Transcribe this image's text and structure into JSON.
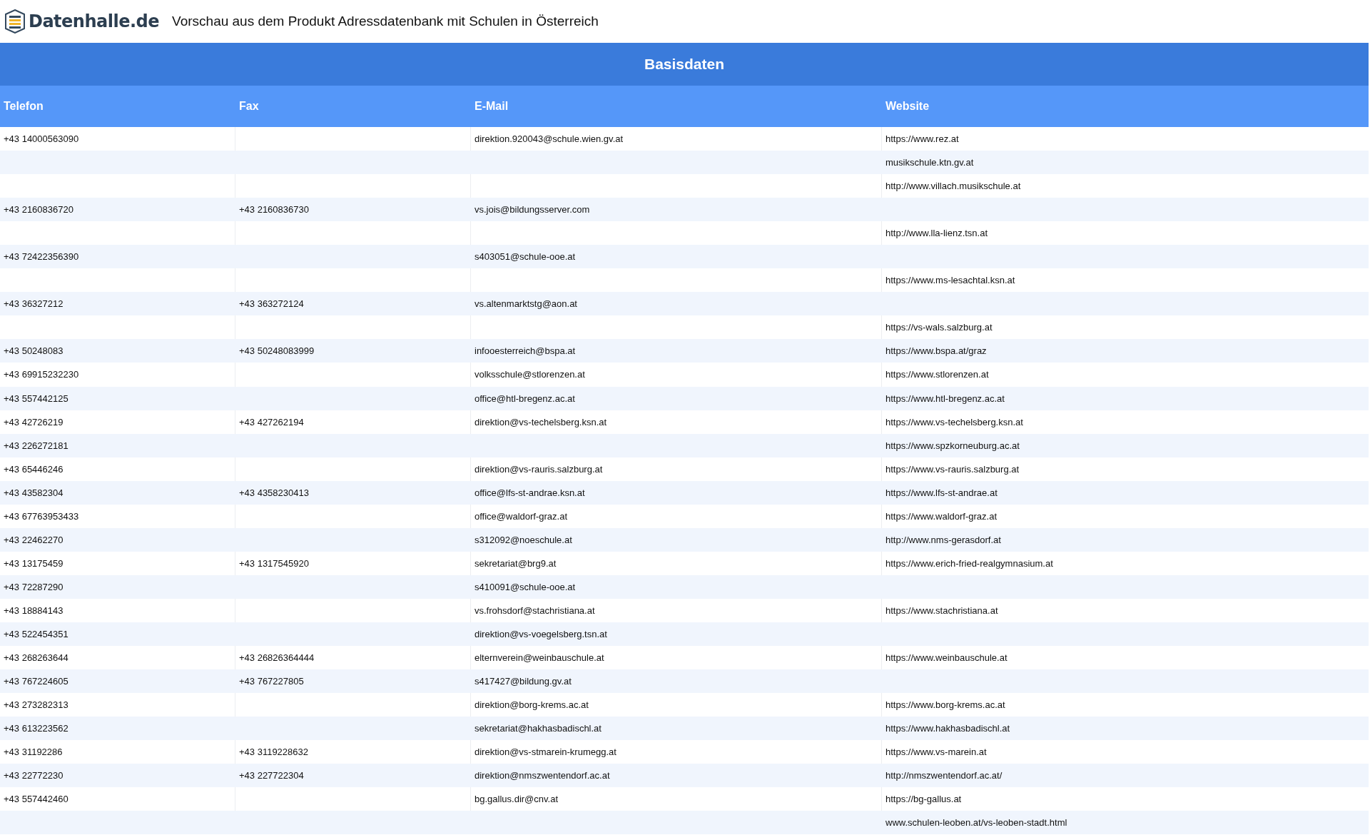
{
  "header": {
    "logo_text": "Datenhalle.de",
    "title": "Vorschau aus dem Produkt Adressdatenbank mit Schulen in Österreich"
  },
  "table": {
    "title": "Basisdaten",
    "columns": [
      "Telefon",
      "Fax",
      "E-Mail",
      "Website"
    ],
    "rows": [
      {
        "telefon": "+43 14000563090",
        "email": "direktion.920043@schule.wien.gv.at",
        "website": "https://www.rez.at"
      },
      {
        "website": "musikschule.ktn.gv.at"
      },
      {
        "website": "http://www.villach.musikschule.at"
      },
      {
        "telefon": "+43 2160836720",
        "fax": "+43 2160836730",
        "email": "vs.jois@bildungsserver.com"
      },
      {
        "website": "http://www.lla-lienz.tsn.at"
      },
      {
        "telefon": "+43 72422356390",
        "email": "s403051@schule-ooe.at"
      },
      {
        "website": "https://www.ms-lesachtal.ksn.at"
      },
      {
        "telefon": "+43 36327212",
        "fax": "+43 363272124",
        "email": "vs.altenmarktstg@aon.at"
      },
      {
        "website": "https://vs-wals.salzburg.at"
      },
      {
        "telefon": "+43 50248083",
        "fax": "+43 50248083999",
        "email": "infooesterreich@bspa.at",
        "website": "https://www.bspa.at/graz"
      },
      {
        "telefon": "+43 69915232230",
        "email": "volksschule@stlorenzen.at",
        "website": "https://www.stlorenzen.at"
      },
      {
        "telefon": "+43 557442125",
        "email": "office@htl-bregenz.ac.at",
        "website": "https://www.htl-bregenz.ac.at"
      },
      {
        "telefon": "+43 42726219",
        "fax": "+43 427262194",
        "email": "direktion@vs-techelsberg.ksn.at",
        "website": "https://www.vs-techelsberg.ksn.at"
      },
      {
        "telefon": "+43 226272181",
        "website": "https://www.spzkorneuburg.ac.at"
      },
      {
        "telefon": "+43 65446246",
        "email": "direktion@vs-rauris.salzburg.at",
        "website": "https://www.vs-rauris.salzburg.at"
      },
      {
        "telefon": "+43 43582304",
        "fax": "+43 4358230413",
        "email": "office@lfs-st-andrae.ksn.at",
        "website": "https://www.lfs-st-andrae.at"
      },
      {
        "telefon": "+43 67763953433",
        "email": "office@waldorf-graz.at",
        "website": "https://www.waldorf-graz.at"
      },
      {
        "telefon": "+43 22462270",
        "email": "s312092@noeschule.at",
        "website": "http://www.nms-gerasdorf.at"
      },
      {
        "telefon": "+43 13175459",
        "fax": "+43 1317545920",
        "email": "sekretariat@brg9.at",
        "website": "https://www.erich-fried-realgymnasium.at"
      },
      {
        "telefon": "+43 72287290",
        "email": "s410091@schule-ooe.at"
      },
      {
        "telefon": "+43 18884143",
        "email": "vs.frohsdorf@stachristiana.at",
        "website": "https://www.stachristiana.at"
      },
      {
        "telefon": "+43 522454351",
        "email": "direktion@vs-voegelsberg.tsn.at"
      },
      {
        "telefon": "+43 268263644",
        "fax": "+43 26826364444",
        "email": "elternverein@weinbauschule.at",
        "website": "https://www.weinbauschule.at"
      },
      {
        "telefon": "+43 767224605",
        "fax": "+43 767227805",
        "email": "s417427@bildung.gv.at"
      },
      {
        "telefon": "+43 273282313",
        "email": "direktion@borg-krems.ac.at",
        "website": "https://www.borg-krems.ac.at"
      },
      {
        "telefon": "+43 613223562",
        "email": "sekretariat@hakhasbadischl.at",
        "website": "https://www.hakhasbadischl.at"
      },
      {
        "telefon": "+43 31192286",
        "fax": "+43 3119228632",
        "email": "direktion@vs-stmarein-krumegg.at",
        "website": "https://www.vs-marein.at"
      },
      {
        "telefon": "+43 22772230",
        "fax": "+43 227722304",
        "email": "direktion@nmszwentendorf.ac.at",
        "website": "http://nmszwentendorf.ac.at/"
      },
      {
        "telefon": "+43 557442460",
        "email": "bg.gallus.dir@cnv.at",
        "website": "https://bg-gallus.at"
      },
      {
        "website": "www.schulen-leoben.at/vs-leoben-stadt.html"
      }
    ]
  }
}
